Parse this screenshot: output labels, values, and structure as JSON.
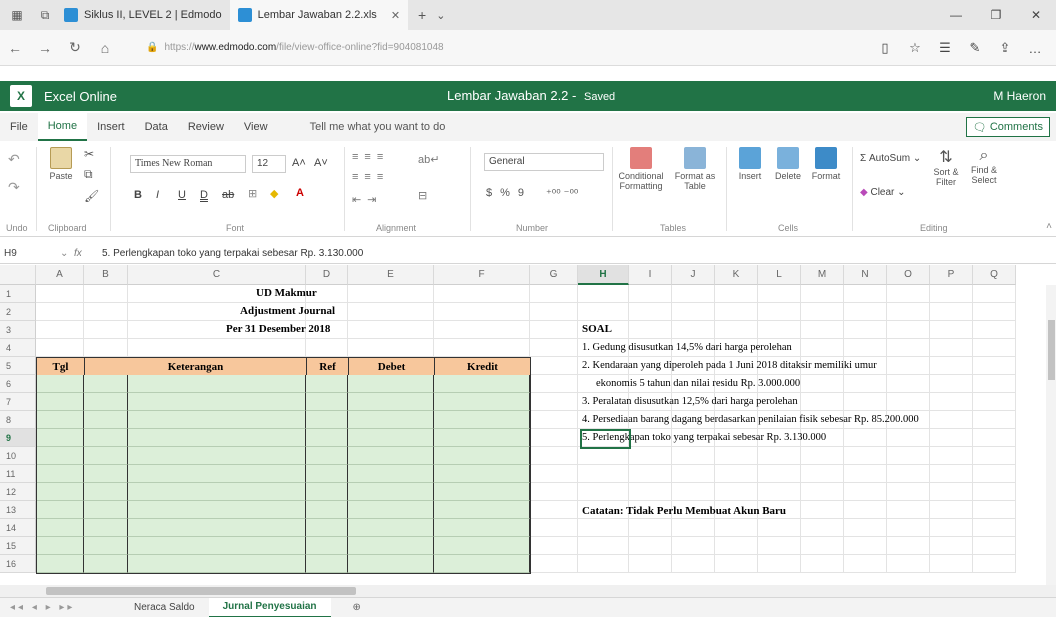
{
  "browser": {
    "tabs": [
      {
        "label": "Siklus II, LEVEL 2 | Edmodo"
      },
      {
        "label": "Lembar Jawaban 2.2.xls"
      }
    ],
    "url_prefix": "https://",
    "url_domain": "www.edmodo.com",
    "url_path": "/file/view-office-online?fid=904081048"
  },
  "excel": {
    "app_name": "Excel Online",
    "doc_title": "Lembar Jawaban 2.2",
    "doc_sep": " - ",
    "doc_status": "Saved",
    "user": "M Haeron",
    "logo_letter": "X"
  },
  "ribbon_tabs": [
    "File",
    "Home",
    "Insert",
    "Data",
    "Review",
    "View",
    "Tell me what you want to do"
  ],
  "comments_label": "Comments",
  "ribbon": {
    "undo": "Undo",
    "paste": "Paste",
    "clipboard": "Clipboard",
    "font_name": "Times New Roman",
    "font_size": "12",
    "font_group": "Font",
    "alignment_group": "Alignment",
    "number_format": "General",
    "number_group": "Number",
    "conditional": "Conditional Formatting",
    "format_table": "Format as Table",
    "tables_group": "Tables",
    "insert": "Insert",
    "delete": "Delete",
    "format": "Format",
    "cells_group": "Cells",
    "autosum": "AutoSum",
    "clear": "Clear",
    "sort_filter": "Sort & Filter",
    "find_select": "Find & Select",
    "editing_group": "Editing"
  },
  "formula_bar": {
    "cell_ref": "H9",
    "fx": "fx",
    "content": "5. Perlengkapan toko yang terpakai sebesar Rp. 3.130.000"
  },
  "columns": [
    "A",
    "B",
    "C",
    "D",
    "E",
    "F",
    "G",
    "H",
    "I",
    "J",
    "K",
    "L",
    "M",
    "N",
    "O",
    "P",
    "Q"
  ],
  "rows": [
    "1",
    "2",
    "3",
    "4",
    "5",
    "6",
    "7",
    "8",
    "9",
    "10",
    "11",
    "12",
    "13",
    "14",
    "15",
    "16"
  ],
  "sheet": {
    "title1": "UD Makmur",
    "title2": "Adjustment Journal",
    "title3": "Per 31 Desember 2018",
    "headers": {
      "tgl": "Tgl",
      "keterangan": "Keterangan",
      "ref": "Ref",
      "debet": "Debet",
      "kredit": "Kredit"
    },
    "soal_title": "SOAL",
    "soal": [
      "1. Gedung disusutkan 14,5% dari harga perolehan",
      "2. Kendaraan yang diperoleh pada 1 Juni 2018 ditaksir memiliki umur",
      "ekonomis 5 tahun dan nilai residu Rp. 3.000.000",
      "3. Peralatan disusutkan 12,5% dari harga perolehan",
      "4. Persediaan barang dagang berdasarkan penilaian fisik sebesar Rp. 85.200.000",
      "5. Perlengkapan toko yang terpakai sebesar Rp. 3.130.000"
    ],
    "catatan": "Catatan: Tidak Perlu Membuat Akun Baru"
  },
  "sheet_tabs": [
    "Neraca Saldo",
    "Jurnal Penyesuaian"
  ],
  "colors": {
    "excel_green": "#217346",
    "header_fill": "#f7c79c",
    "body_fill": "#dcefd9"
  }
}
